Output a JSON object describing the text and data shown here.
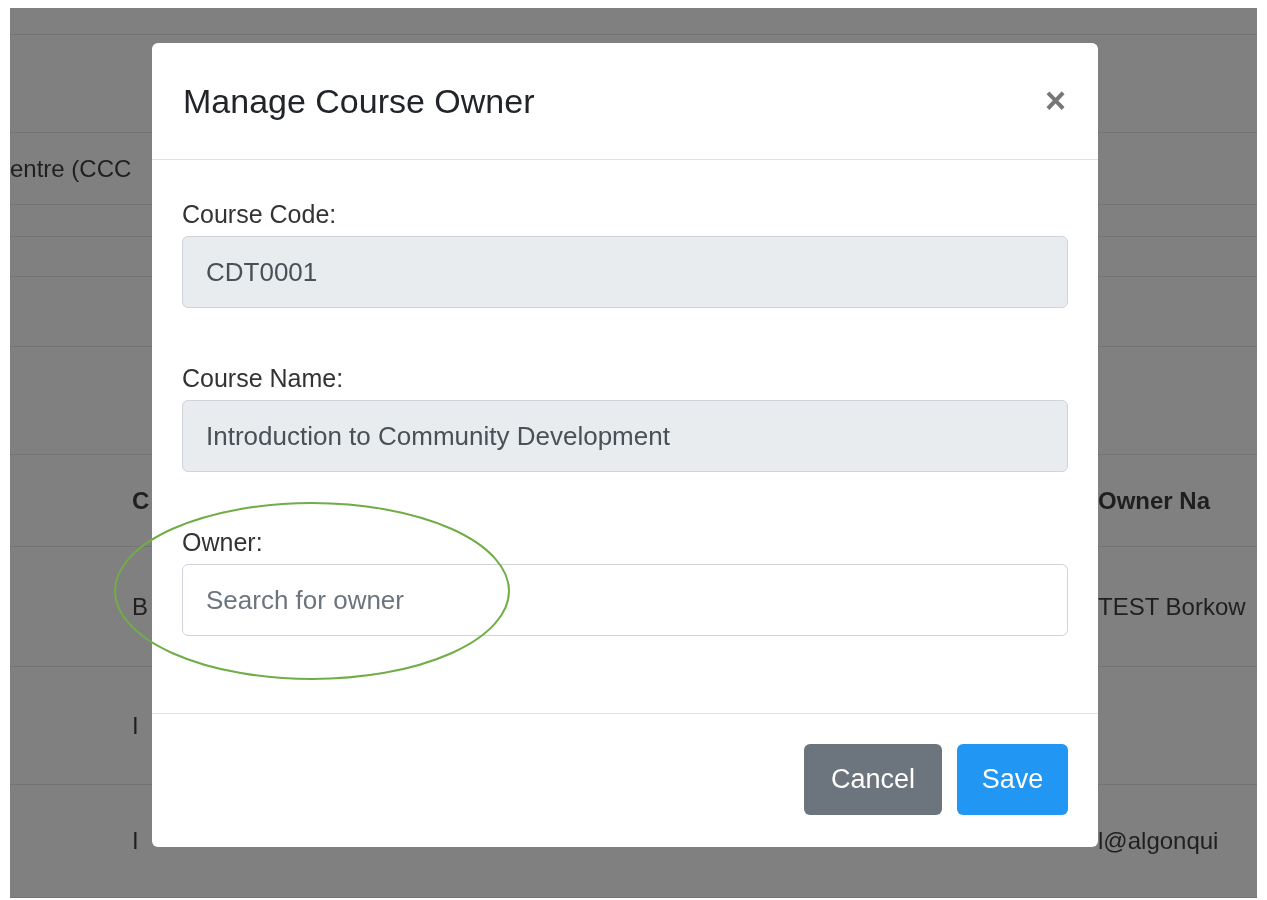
{
  "background_table": {
    "rows": [
      {
        "kind": "cell",
        "column_1": "entre (CCC"
      },
      {
        "kind": "header",
        "column_1": "C",
        "column_2": "Owner Na"
      },
      {
        "kind": "cell",
        "column_1": "B",
        "column_2": "TEST Borkow"
      },
      {
        "kind": "cell",
        "column_1": "I"
      },
      {
        "kind": "cell",
        "column_1": "I",
        "column_2": "l@algonqui"
      }
    ]
  },
  "modal": {
    "title": "Manage Course Owner",
    "close": "×",
    "fields": [
      {
        "label": "Course Code:",
        "value": "CDT0001",
        "disabled": true
      },
      {
        "label": "Course Name:",
        "value": "Introduction to Community Development",
        "disabled": true
      },
      {
        "label": "Owner:",
        "placeholder": "Search for owner",
        "disabled": false
      }
    ],
    "buttons": [
      {
        "label": "Cancel",
        "kind": "secondary"
      },
      {
        "label": "Save",
        "kind": "primary"
      }
    ]
  },
  "annotation": {
    "kind": "ellipse",
    "color": "#70ad47"
  }
}
